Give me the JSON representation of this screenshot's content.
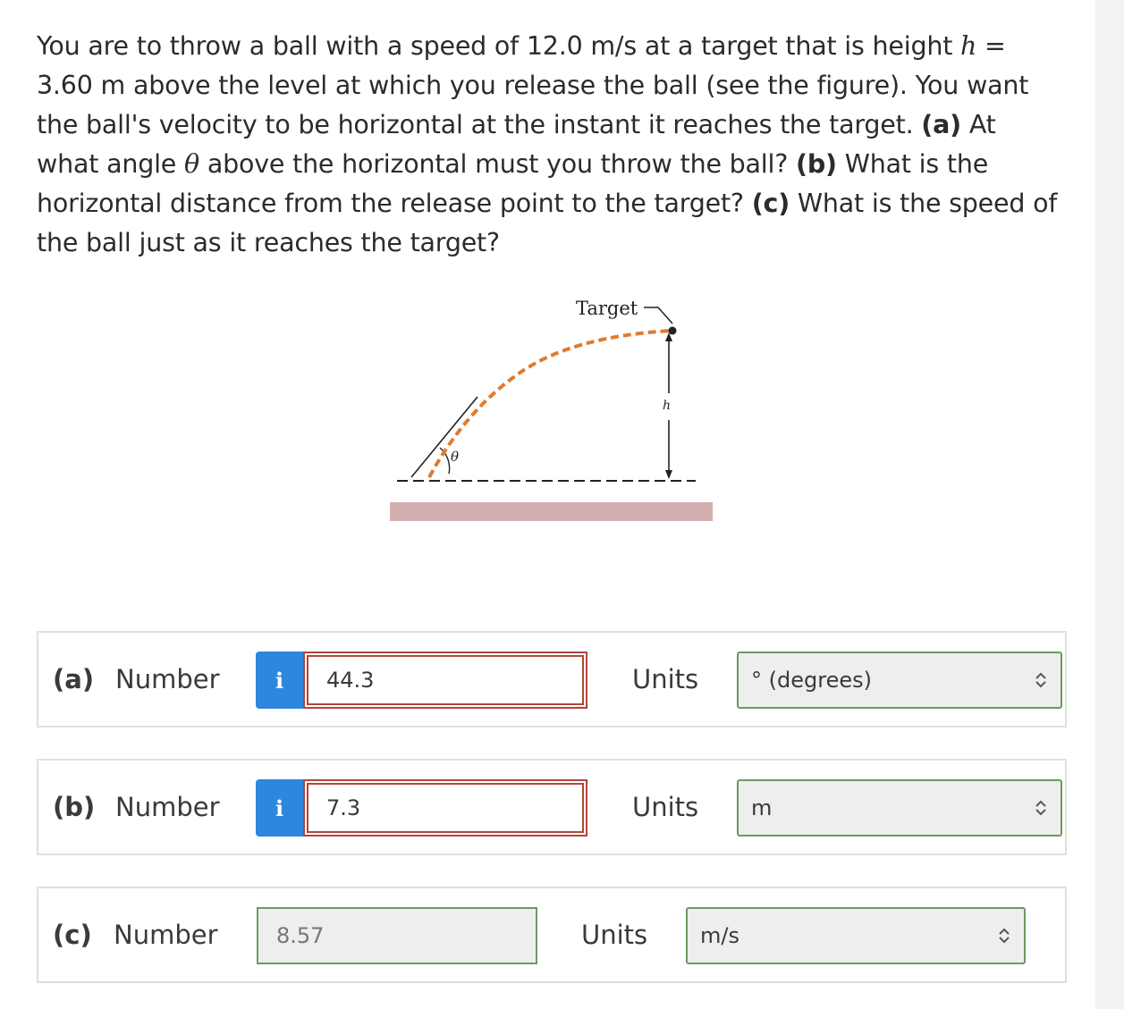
{
  "question": {
    "t1": "You are to throw a ball with a speed of 12.0 m/s at a target that is height ",
    "h_var": "h",
    "t2": " = 3.60 m above the level at which you release the ball (see the figure). You want the ball's velocity to be horizontal at the instant it reaches the target. ",
    "a_tag": "(a)",
    "t3": " At what angle ",
    "theta_var": "θ",
    "t4": " above the horizontal must you throw the ball? ",
    "b_tag": "(b)",
    "t5": " What is the horizontal distance from the release point to the target? ",
    "c_tag": "(c)",
    "t6": " What is the speed of the ball just as it reaches the target?"
  },
  "figure": {
    "target_label": "Target",
    "h_label": "h",
    "theta_label": "θ",
    "colors": {
      "trajectory": "#e07b2e",
      "ground": "#d4aeb0",
      "lines": "#222222"
    }
  },
  "answers": [
    {
      "part": "(a)",
      "number_label": "Number",
      "info_icon": "i",
      "value": "44.3",
      "units_label": "Units",
      "units_value": "° (degrees)",
      "status": "incorrect"
    },
    {
      "part": "(b)",
      "number_label": "Number",
      "info_icon": "i",
      "value": "7.3",
      "units_label": "Units",
      "units_value": "m",
      "status": "incorrect"
    },
    {
      "part": "(c)",
      "number_label": "Number",
      "value": "8.57",
      "units_label": "Units",
      "units_value": "m/s",
      "status": "correct"
    }
  ],
  "colors": {
    "info_button": "#2e86de",
    "incorrect_border": "#b2453b",
    "correct_border": "#6b9b62"
  }
}
